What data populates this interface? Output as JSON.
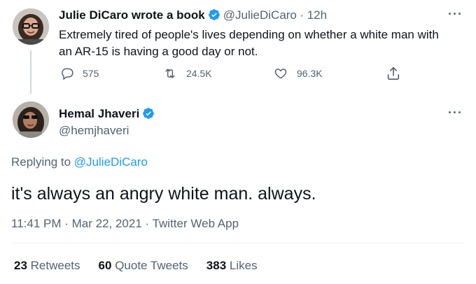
{
  "quoted_tweet": {
    "author_name": "Julie DiCaro wrote a book",
    "author_handle": "@JulieDiCaro",
    "time": "· 12h",
    "text_line1": "Extremely tired of people's lives depending on whether a white man with",
    "text_line2": "an AR-15 is having a good day or not.",
    "reply_count": "575",
    "retweet_count": "24.5K",
    "like_count": "96.3K"
  },
  "main_tweet": {
    "author_name": "Hemal Jhaveri",
    "author_handle": "@hemjhaveri",
    "replying_prefix": "Replying to",
    "replying_to": "@JulieDiCaro",
    "text": "it's always an angry white man. always.",
    "timestamp": "11:41 PM · Mar 22, 2021 · Twitter Web App",
    "stats": {
      "retweets_value": "23",
      "retweets_label": "Retweets",
      "quotes_value": "60",
      "quotes_label": "Quote Tweets",
      "likes_value": "383",
      "likes_label": "Likes"
    }
  },
  "more_glyph": "···",
  "colors": {
    "verified": "#1d9bf0",
    "link": "#1d9bf0",
    "secondary_text": "#536471",
    "primary_text": "#0f1419"
  },
  "icons": [
    "verified-badge-icon",
    "reply-icon",
    "retweet-icon",
    "like-icon",
    "share-icon",
    "more-icon"
  ]
}
